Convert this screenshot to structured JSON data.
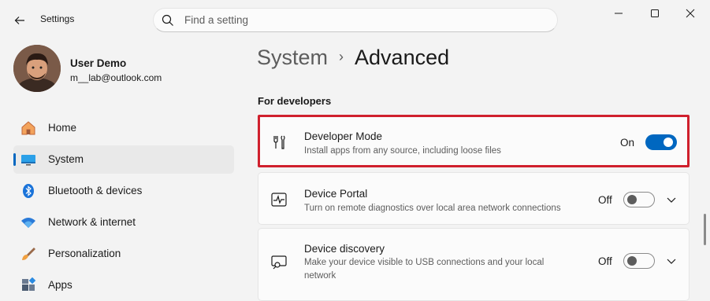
{
  "window": {
    "title": "Settings",
    "search_placeholder": "Find a setting"
  },
  "user": {
    "name": "User Demo",
    "email": "m__lab@outlook.com"
  },
  "sidebar": {
    "items": [
      {
        "label": "Home",
        "icon": "home-icon"
      },
      {
        "label": "System",
        "icon": "monitor-icon",
        "active": true
      },
      {
        "label": "Bluetooth & devices",
        "icon": "bluetooth-icon"
      },
      {
        "label": "Network & internet",
        "icon": "wifi-icon"
      },
      {
        "label": "Personalization",
        "icon": "brush-icon"
      },
      {
        "label": "Apps",
        "icon": "apps-icon"
      }
    ]
  },
  "breadcrumb": {
    "parent": "System",
    "separator": "›",
    "current": "Advanced"
  },
  "section": {
    "label": "For developers"
  },
  "settings": [
    {
      "title": "Developer Mode",
      "description": "Install apps from any source, including loose files",
      "state": "On",
      "icon": "developer-tools-icon"
    },
    {
      "title": "Device Portal",
      "description": "Turn on remote diagnostics over local area network connections",
      "state": "Off",
      "icon": "pulse-icon"
    },
    {
      "title": "Device discovery",
      "description": "Make your device visible to USB connections and your local network",
      "state": "Off",
      "icon": "device-search-icon"
    }
  ],
  "colors": {
    "accent": "#0067c0",
    "highlight_border": "#d0202d",
    "background": "#f3f3f3"
  }
}
